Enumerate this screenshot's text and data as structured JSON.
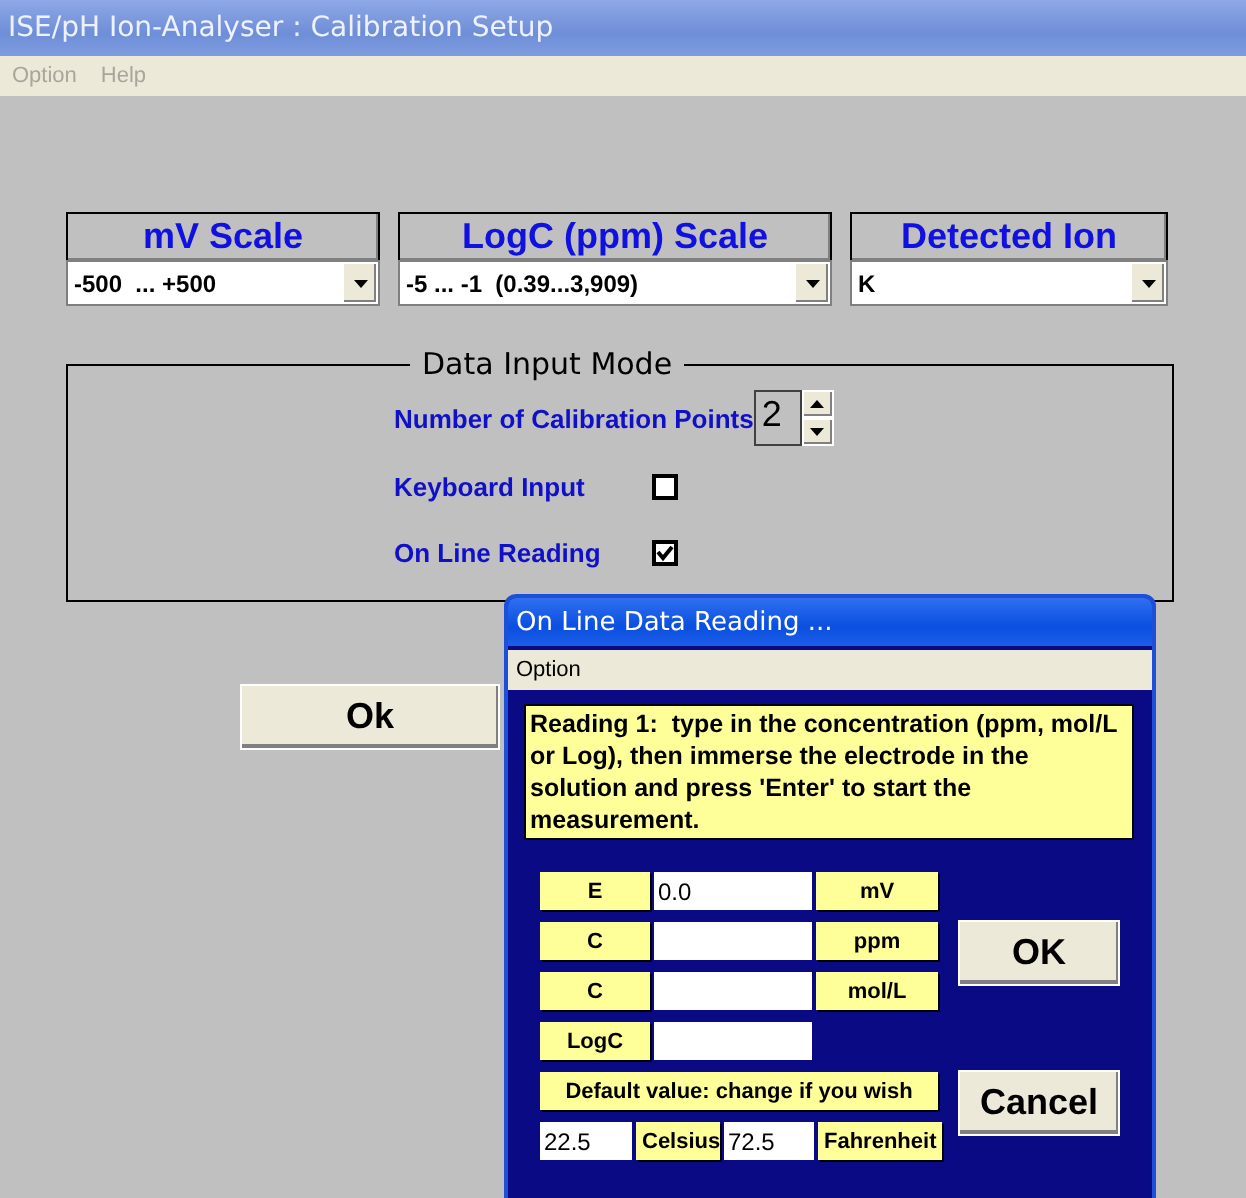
{
  "window": {
    "title": "ISE/pH Ion-Analyser : Calibration Setup"
  },
  "menu": [
    {
      "label": "Option",
      "disabled": true
    },
    {
      "label": "Help",
      "disabled": true
    }
  ],
  "scales": [
    {
      "heading": "mV Scale",
      "value": "-500  ... +500"
    },
    {
      "heading": "LogC (ppm) Scale",
      "value": "-5 ... -1  (0.39...3,909)"
    },
    {
      "heading": "Detected Ion",
      "value": "K"
    }
  ],
  "data_input_mode": {
    "title": "Data Input Mode",
    "calibration_points": {
      "label": "Number of Calibration Points",
      "value": "2"
    },
    "options": [
      {
        "label": "Keyboard Input",
        "checked": false
      },
      {
        "label": "On Line Reading",
        "checked": true
      }
    ]
  },
  "ok_button": "Ok",
  "dialog": {
    "title": "On Line Data Reading ...",
    "menu": [
      "Option"
    ],
    "instructions": "Reading 1:  type in the concentration (ppm, mol/L or Log), then immerse the electrode in the solution and press 'Enter' to start the measurement.",
    "rows": [
      {
        "label": "E",
        "value": "0.0",
        "unit": "mV"
      },
      {
        "label": "C",
        "unit": "ppm"
      },
      {
        "label": "C",
        "unit": "mol/L"
      },
      {
        "label": "LogC"
      }
    ],
    "default_note": "Default value: change if you wish",
    "temperature": [
      {
        "value": "22.5",
        "unit": "Celsius"
      },
      {
        "value": "72.5",
        "unit": "Fahrenheit"
      }
    ],
    "buttons": [
      "OK",
      "Cancel"
    ]
  }
}
